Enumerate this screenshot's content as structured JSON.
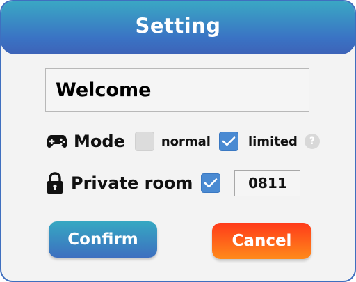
{
  "dialog": {
    "title": "Setting"
  },
  "name_field": {
    "value": "Welcome"
  },
  "mode": {
    "icon": "gamepad-icon",
    "label": "Mode",
    "options": [
      {
        "label": "normal",
        "checked": false
      },
      {
        "label": "limited",
        "checked": true
      }
    ],
    "help_icon": "question-icon",
    "help_text": "?"
  },
  "private_room": {
    "icon": "lock-icon",
    "label": "Private room",
    "checked": true,
    "code": "0811"
  },
  "buttons": {
    "confirm_label": "Confirm",
    "cancel_label": "Cancel"
  },
  "colors": {
    "title_gradient_top": "#3aa9c4",
    "title_gradient_bottom": "#3d63b8",
    "checkbox_on": "#4a8ad2",
    "cancel_gradient_top": "#ff3a1a",
    "cancel_gradient_bottom": "#ff8a1a"
  }
}
